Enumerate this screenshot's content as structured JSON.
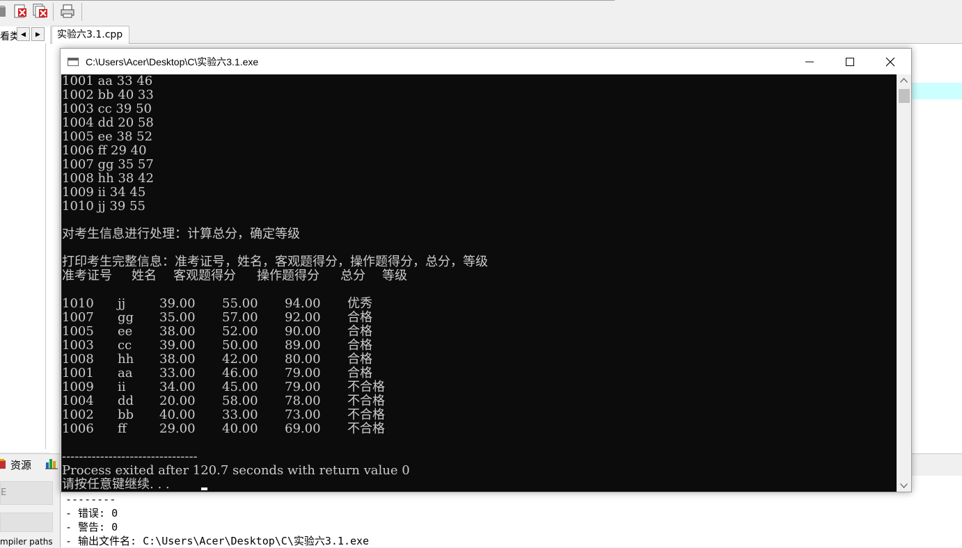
{
  "ide": {
    "left_tab_label": "看类",
    "file_tab": "实验六3.1.cpp",
    "resources_tab": "资源",
    "bottom_box_label": "E",
    "compiler_paths_label": "mpiler paths",
    "output_lines": [
      "--------",
      "- 错误: 0",
      "- 警告: 0",
      "- 输出文件名: C:\\Users\\Acer\\Desktop\\C\\实验六3.1.exe"
    ]
  },
  "console": {
    "title": "C:\\Users\\Acer\\Desktop\\C\\实验六3.1.exe",
    "input_rows": [
      "1001 aa 33 46",
      "1002 bb 40 33",
      "1003 cc 39 50",
      "1004 dd 20 58",
      "1005 ee 38 52",
      "1006 ff 29 40",
      "1007 gg 35 57",
      "1008 hh 38 42",
      "1009 ii 34 45",
      "1010 jj 39 55"
    ],
    "processing_msg": "对考生信息进行处理：计算总分，确定等级",
    "print_msg": "打印考生完整信息：准考证号，姓名，客观题得分，操作题得分，总分，等级",
    "headers": [
      "准考证号",
      "姓名",
      "客观题得分",
      "操作题得分",
      "总分",
      "等级"
    ],
    "result_rows": [
      {
        "id": "1010",
        "name": "jj",
        "obj": "39.00",
        "op": "55.00",
        "total": "94.00",
        "grade": "优秀"
      },
      {
        "id": "1007",
        "name": "gg",
        "obj": "35.00",
        "op": "57.00",
        "total": "92.00",
        "grade": "合格"
      },
      {
        "id": "1005",
        "name": "ee",
        "obj": "38.00",
        "op": "52.00",
        "total": "90.00",
        "grade": "合格"
      },
      {
        "id": "1003",
        "name": "cc",
        "obj": "39.00",
        "op": "50.00",
        "total": "89.00",
        "grade": "合格"
      },
      {
        "id": "1008",
        "name": "hh",
        "obj": "38.00",
        "op": "42.00",
        "total": "80.00",
        "grade": "合格"
      },
      {
        "id": "1001",
        "name": "aa",
        "obj": "33.00",
        "op": "46.00",
        "total": "79.00",
        "grade": "合格"
      },
      {
        "id": "1009",
        "name": "ii",
        "obj": "34.00",
        "op": "45.00",
        "total": "79.00",
        "grade": "不合格"
      },
      {
        "id": "1004",
        "name": "dd",
        "obj": "20.00",
        "op": "58.00",
        "total": "78.00",
        "grade": "不合格"
      },
      {
        "id": "1002",
        "name": "bb",
        "obj": "40.00",
        "op": "33.00",
        "total": "73.00",
        "grade": "不合格"
      },
      {
        "id": "1006",
        "name": "ff",
        "obj": "29.00",
        "op": "40.00",
        "total": "69.00",
        "grade": "不合格"
      }
    ],
    "separator": "--------------------------------",
    "exit_msg": "Process exited after 120.7 seconds with return value 0",
    "press_key_msg": "请按任意键继续. . ."
  },
  "icons": {
    "toolbar": [
      "close-file-icon",
      "close-all-icon",
      "print-icon"
    ],
    "window": [
      "minimize-icon",
      "maximize-icon",
      "close-icon"
    ]
  },
  "colors": {
    "console_bg": "#0c0c0c",
    "console_text": "#cccccc",
    "editor_highlight": "#ccffff"
  }
}
